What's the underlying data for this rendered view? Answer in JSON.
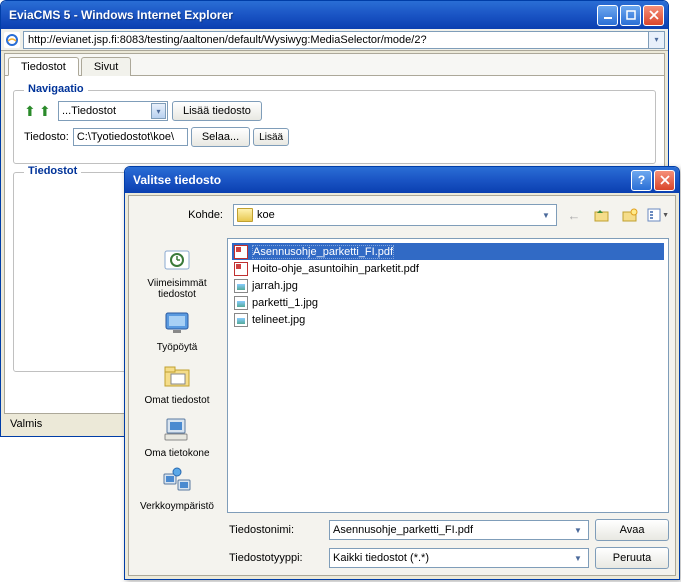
{
  "ie_window": {
    "title": "EviaCMS 5 - Windows Internet Explorer",
    "url": "http://evianet.jsp.fi:8083/testing/aaltonen/default/Wysiwyg:MediaSelector/mode/2?",
    "tabs": [
      {
        "label": "Tiedostot",
        "active": true
      },
      {
        "label": "Sivut",
        "active": false
      }
    ],
    "nav_group": {
      "title": "Navigaatio",
      "folder_select": "...Tiedostot",
      "add_button": "Lisää tiedosto",
      "file_label": "Tiedosto:",
      "file_path": "C:\\Tyotiedostot\\koe\\",
      "browse_button": "Selaa...",
      "add_small": "Lisää"
    },
    "files_group": {
      "title": "Tiedostot"
    },
    "status": "Valmis"
  },
  "file_dialog": {
    "title": "Valitse tiedosto",
    "look_in_label": "Kohde:",
    "look_in_value": "koe",
    "places": [
      {
        "label": "Viimeisimmät tiedostot",
        "icon": "recent"
      },
      {
        "label": "Työpöytä",
        "icon": "desktop"
      },
      {
        "label": "Omat tiedostot",
        "icon": "mydocs"
      },
      {
        "label": "Oma tietokone",
        "icon": "mycomputer"
      },
      {
        "label": "Verkkoympäristö",
        "icon": "network"
      }
    ],
    "files": [
      {
        "name": "Asennusohje_parketti_FI.pdf",
        "type": "pdf",
        "selected": true
      },
      {
        "name": "Hoito-ohje_asuntoihin_parketit.pdf",
        "type": "pdf",
        "selected": false
      },
      {
        "name": "jarrah.jpg",
        "type": "jpg",
        "selected": false
      },
      {
        "name": "parketti_1.jpg",
        "type": "jpg",
        "selected": false
      },
      {
        "name": "telineet.jpg",
        "type": "jpg",
        "selected": false
      }
    ],
    "filename_label": "Tiedostonimi:",
    "filename_value": "Asennusohje_parketti_FI.pdf",
    "filetype_label": "Tiedostotyyppi:",
    "filetype_value": "Kaikki tiedostot (*.*)",
    "open_button": "Avaa",
    "cancel_button": "Peruuta"
  }
}
